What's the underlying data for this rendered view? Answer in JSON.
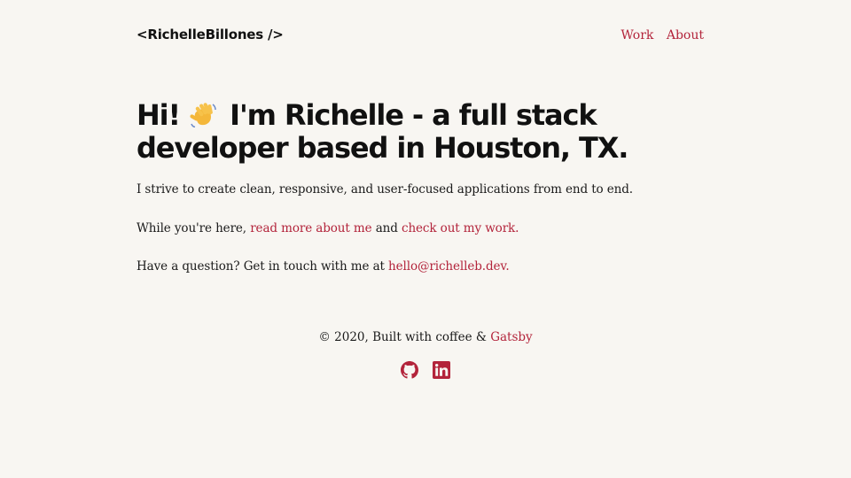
{
  "header": {
    "logo": "<RichelleBillones />",
    "nav": [
      {
        "label": "Work"
      },
      {
        "label": "About"
      }
    ]
  },
  "hero": {
    "greeting": "Hi!",
    "wave_icon": "waving-hand-emoji",
    "headline": "I'm Richelle - a full stack developer based in Houston, TX."
  },
  "intro": {
    "line1": "I strive to create clean, responsive, and user-focused applications from end to end.",
    "line2_prefix": "While you're here, ",
    "line2_link1": "read more about me",
    "line2_middle": " and ",
    "line2_link2": "check out my work.",
    "line3_prefix": "Have a question? Get in touch with me at ",
    "line3_email": "hello@richelleb.dev."
  },
  "footer": {
    "text": "© 2020, Built with coffee & ",
    "link": "Gatsby",
    "social": [
      {
        "icon": "github-icon"
      },
      {
        "icon": "linkedin-icon"
      }
    ]
  },
  "colors": {
    "background": "#f8f6f2",
    "accent": "#b3243b",
    "text": "#111111"
  }
}
